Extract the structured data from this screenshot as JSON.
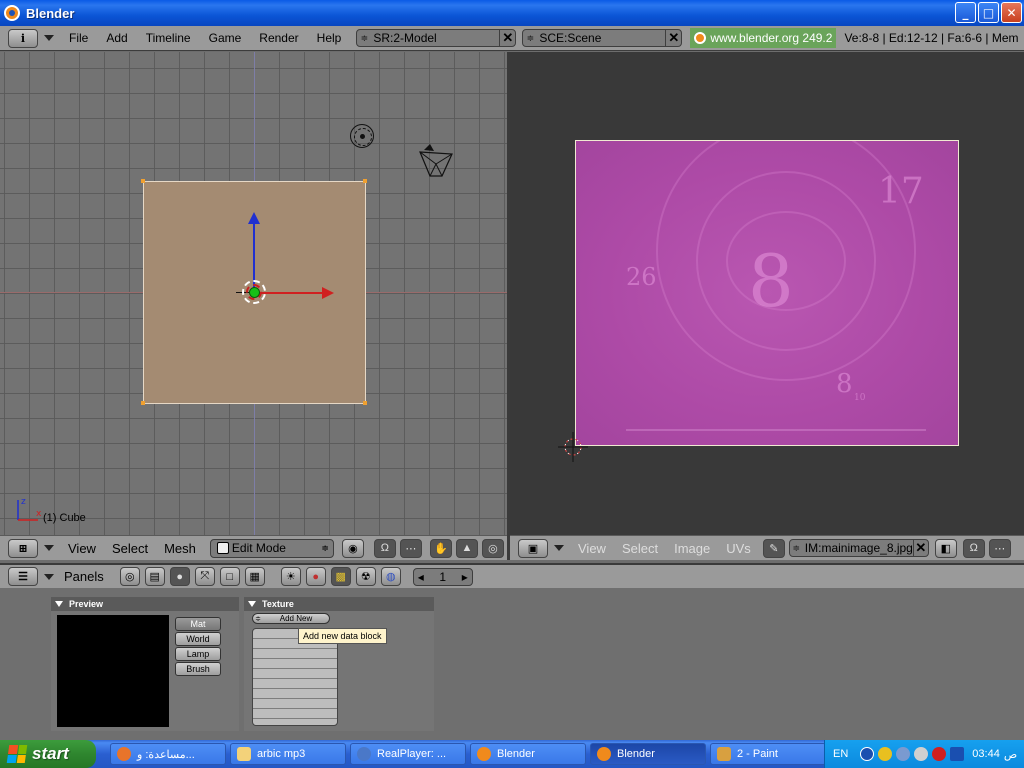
{
  "window": {
    "title": "Blender",
    "minimize": "_",
    "maximize": "□",
    "close": "✕"
  },
  "info_header": {
    "menus": [
      "File",
      "Add",
      "Timeline",
      "Game",
      "Render",
      "Help"
    ],
    "screen": "SR:2-Model",
    "scene": "SCE:Scene",
    "url": "www.blender.org 249.2",
    "stats": "Ve:8-8 | Ed:12-12 | Fa:6-6 | Mem"
  },
  "viewport3d": {
    "object_label": "(1) Cube",
    "axes_labels": {
      "z": "z",
      "x": "x"
    },
    "header": {
      "menus": [
        "View",
        "Select",
        "Mesh"
      ],
      "mode": "Edit Mode"
    }
  },
  "image_editor": {
    "image_numbers": [
      "8",
      "17",
      "26",
      "8",
      "10"
    ],
    "header": {
      "menus": [
        "View",
        "Select",
        "Image",
        "UVs"
      ],
      "image_name": "IM:mainimage_8.jpg"
    }
  },
  "buttons_window": {
    "header": {
      "label": "Panels",
      "frame": "1"
    },
    "preview_panel": {
      "title": "Preview",
      "buttons": [
        "Mat",
        "World",
        "Lamp",
        "Brush"
      ],
      "active": "Mat"
    },
    "texture_panel": {
      "title": "Texture",
      "add_new": "Add New",
      "tooltip": "Add new data block"
    }
  },
  "taskbar": {
    "start": "start",
    "tasks": [
      {
        "label": "مساعدة: و...",
        "icon": "firefox-icon",
        "color": "#e8742a"
      },
      {
        "label": "arbic mp3",
        "icon": "folder-icon",
        "color": "#f3d27a"
      },
      {
        "label": "RealPlayer: ...",
        "icon": "realplayer-icon",
        "color": "#4a78c8"
      },
      {
        "label": "Blender",
        "icon": "blender-icon",
        "color": "#f08a1c"
      },
      {
        "label": "Blender",
        "icon": "blender-icon",
        "color": "#f08a1c",
        "active": true
      },
      {
        "label": "2 - Paint",
        "icon": "paint-icon",
        "color": "#d8a040"
      }
    ],
    "tray": {
      "lang": "EN",
      "time": "03:44",
      "ampm": "ص"
    }
  }
}
